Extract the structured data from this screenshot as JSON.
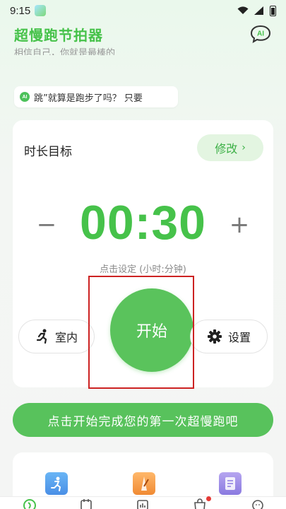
{
  "status_bar": {
    "time": "9:15"
  },
  "header": {
    "title": "超慢跑节拍器",
    "ai_label": "AI",
    "subtitle_partial": "相信自己，你就是最棒的"
  },
  "ai_tip": {
    "badge": "AI",
    "text": "跳”就算是跑步了吗？ 只要"
  },
  "goal_card": {
    "title": "时长目标",
    "edit_label": "修改",
    "minus_label": "−",
    "plus_label": "+",
    "timer_value": "00:30",
    "hint": "点击设定 (小时:分钟)",
    "indoor_label": "室内",
    "settings_label": "设置",
    "start_label": "开始"
  },
  "cta": {
    "label": "点击开始完成您的第一次超慢跑吧"
  },
  "colors": {
    "accent": "#46c24a",
    "button_green": "#5ac35c",
    "highlight": "#cc2222"
  }
}
